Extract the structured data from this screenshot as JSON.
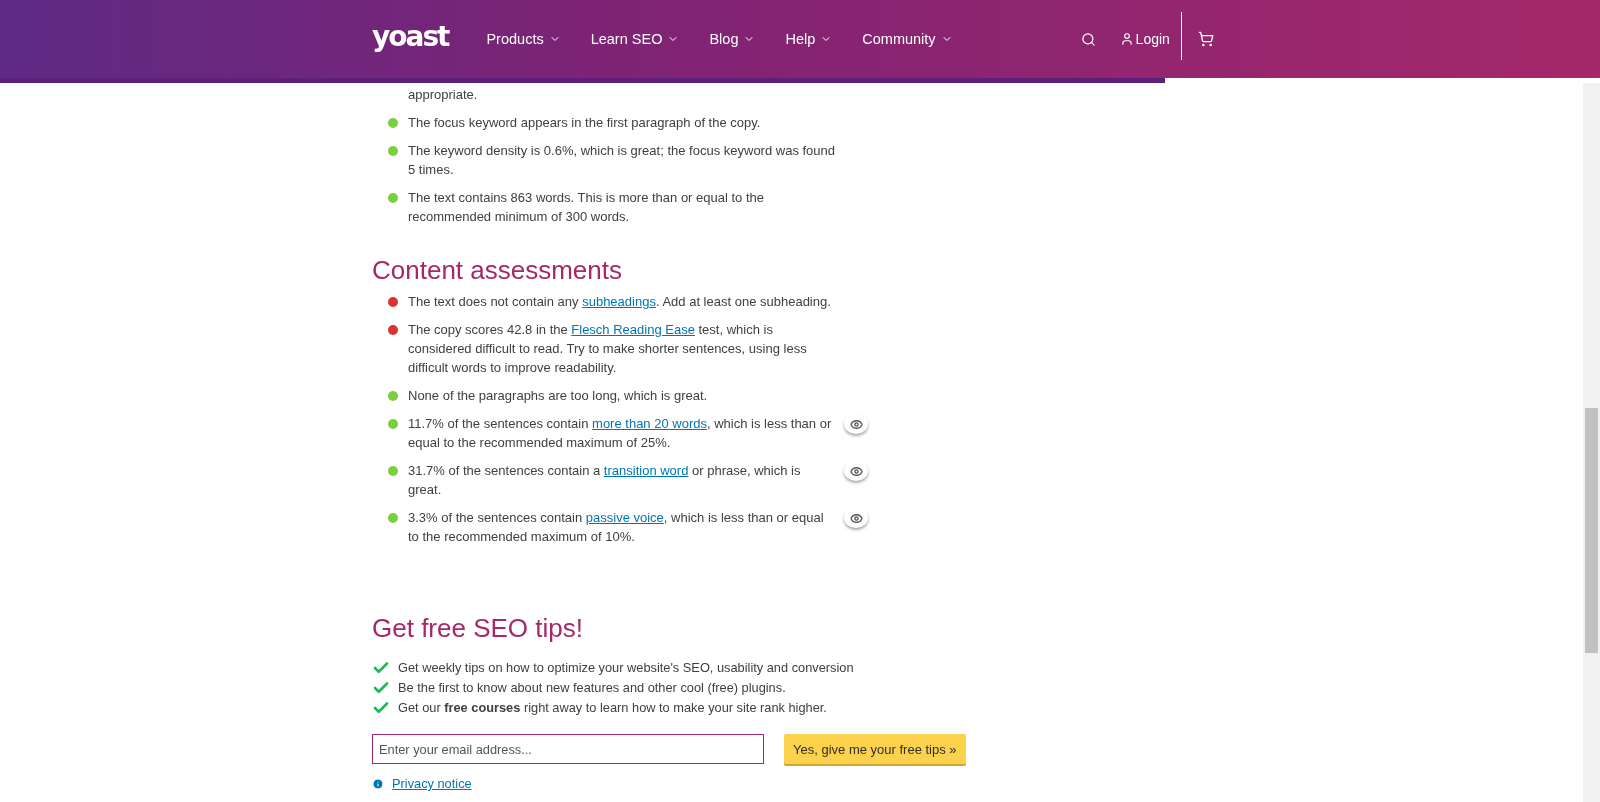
{
  "header": {
    "logo": "yoast",
    "nav": [
      {
        "label": "Products"
      },
      {
        "label": "Learn SEO"
      },
      {
        "label": "Blog"
      },
      {
        "label": "Help"
      },
      {
        "label": "Community"
      }
    ],
    "login": "Login"
  },
  "seo_assessments": {
    "cut_text": "appropriate.",
    "items": [
      {
        "color": "#7ad03a",
        "parts": [
          {
            "text": "The focus keyword appears in the first paragraph of the copy."
          }
        ]
      },
      {
        "color": "#7ad03a",
        "parts": [
          {
            "text": "The keyword density is 0.6%, which is great; the focus keyword was found 5 times."
          }
        ]
      },
      {
        "color": "#7ad03a",
        "parts": [
          {
            "text": "The text contains 863 words. This is more than or equal to the recommended minimum of 300 words."
          }
        ]
      }
    ]
  },
  "content_assessments": {
    "title": "Content assessments",
    "items": [
      {
        "color": "#dc3232",
        "eye": false,
        "parts": [
          {
            "text": "The text does not contain any "
          },
          {
            "link": "subheadings"
          },
          {
            "text": ". Add at least one subheading."
          }
        ]
      },
      {
        "color": "#dc3232",
        "eye": false,
        "parts": [
          {
            "text": "The copy scores 42.8 in the "
          },
          {
            "link": "Flesch Reading Ease"
          },
          {
            "text": " test, which is considered difficult to read. Try to make shorter sentences, using less difficult words to improve readability."
          }
        ]
      },
      {
        "color": "#7ad03a",
        "eye": false,
        "parts": [
          {
            "text": "None of the paragraphs are too long, which is great."
          }
        ]
      },
      {
        "color": "#7ad03a",
        "eye": true,
        "parts": [
          {
            "text": "11.7% of the sentences contain "
          },
          {
            "link": "more than 20 words"
          },
          {
            "text": ", which is less than or equal to the recommended maximum of 25%."
          }
        ]
      },
      {
        "color": "#7ad03a",
        "eye": true,
        "parts": [
          {
            "text": "31.7% of the sentences contain a "
          },
          {
            "link": "transition word"
          },
          {
            "text": " or phrase, which is great."
          }
        ]
      },
      {
        "color": "#7ad03a",
        "eye": true,
        "parts": [
          {
            "text": "3.3% of the sentences contain "
          },
          {
            "link": "passive voice"
          },
          {
            "text": ", which is less than or equal to the recommended maximum of 10%."
          }
        ]
      }
    ]
  },
  "newsletter": {
    "title": "Get free SEO tips!",
    "tips": [
      "Get weekly tips on how to optimize your website's SEO, usability and conversion",
      "Be the first to know about new features and other cool (free) plugins.",
      "Get our **free courses** right away to learn how to make your site rank higher."
    ],
    "email": {
      "placeholder": "Enter your email address..."
    },
    "submit": "Yes, give me your free tips »",
    "privacy": "Privacy notice"
  }
}
